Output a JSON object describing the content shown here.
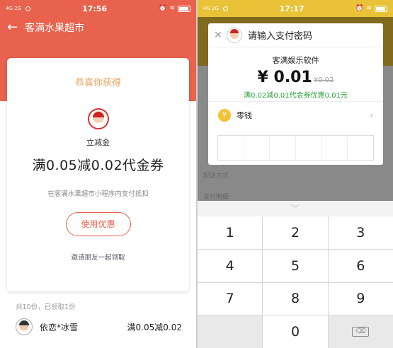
{
  "left": {
    "status": {
      "signal": "4G 2G",
      "time": "17:56"
    },
    "nav_title": "客满水果超市",
    "congrats": "恭喜你获得",
    "coupon_kind": "立减金",
    "coupon_title": "满0.05减0.02代金券",
    "usage_desc": "在客满水果超市小程序内支付抵扣",
    "use_button": "使用优惠",
    "invite_link": "邀请朋友一起领取",
    "claim_count": "共10份，已领取1份",
    "claims": [
      {
        "name": "依恋*冰雪",
        "coupon": "满0.05减0.02"
      }
    ]
  },
  "right": {
    "status": {
      "signal": "4G 2G",
      "time": "17:17"
    },
    "modal_title": "请输入支付密码",
    "merchant": "客满娱乐软件",
    "amount": "¥ 0.01",
    "original_amount": "¥0.02",
    "promo": "满0.02减0.01代金券优惠0.01元",
    "pay_method": {
      "icon": "¥",
      "label": "零钱"
    },
    "bg_labels": [
      "配送方式",
      "支付明细"
    ],
    "keypad": [
      "1",
      "2",
      "3",
      "4",
      "5",
      "6",
      "7",
      "8",
      "9",
      "",
      "0",
      "⌫"
    ]
  },
  "colors": {
    "left_header": "#e8624d",
    "right_header": "#e9c237",
    "promo_green": "#2aa33b"
  }
}
